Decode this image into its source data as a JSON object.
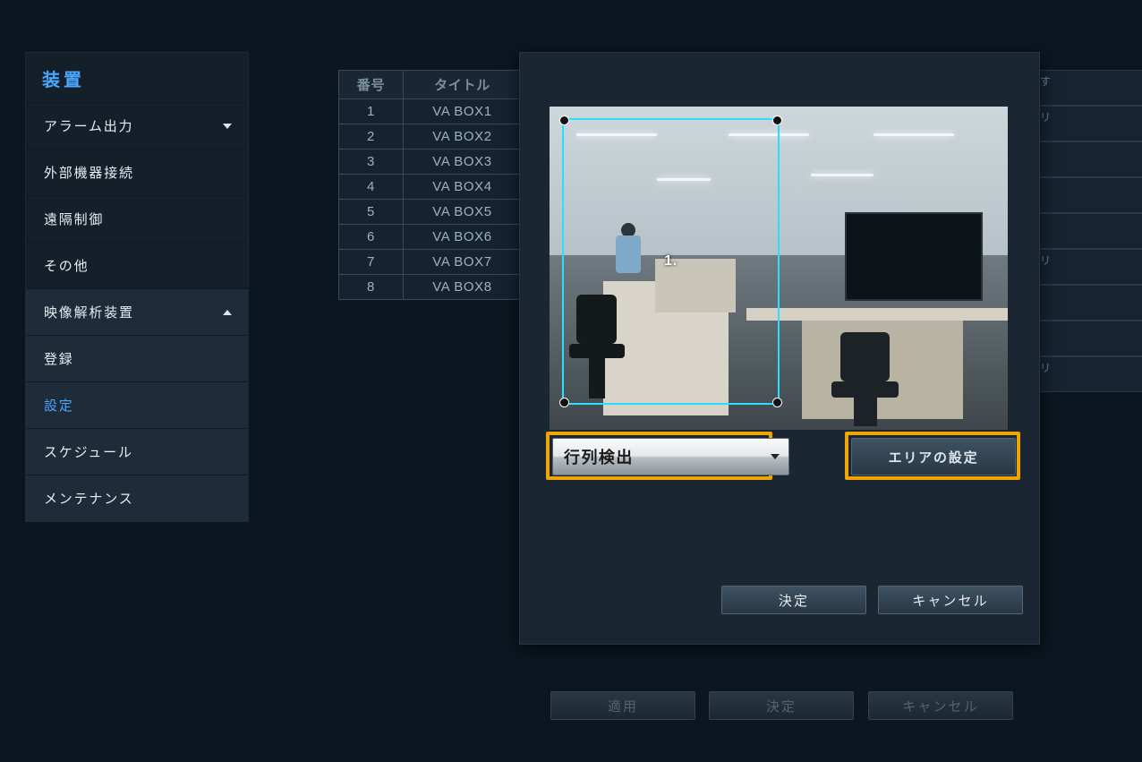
{
  "sidebar": {
    "title": "装置",
    "items": [
      {
        "label": "アラーム出力",
        "type": "collapsible",
        "state": "collapsed"
      },
      {
        "label": "外部機器接続",
        "type": "item"
      },
      {
        "label": "遠隔制御",
        "type": "item"
      },
      {
        "label": "その他",
        "type": "item"
      },
      {
        "label": "映像解析装置",
        "type": "collapsible",
        "state": "expanded",
        "children": [
          {
            "label": "登録"
          },
          {
            "label": "設定",
            "selected": true
          },
          {
            "label": "スケジュール"
          },
          {
            "label": "メンテナンス"
          }
        ]
      }
    ]
  },
  "bg_table": {
    "headers": [
      "番号",
      "タイトル"
    ],
    "rows": [
      [
        "1",
        "VA BOX1"
      ],
      [
        "2",
        "VA BOX2"
      ],
      [
        "3",
        "VA BOX3"
      ],
      [
        "4",
        "VA BOX4"
      ],
      [
        "5",
        "VA BOX5"
      ],
      [
        "6",
        "VA BOX6"
      ],
      [
        "7",
        "VA BOX7"
      ],
      [
        "8",
        "VA BOX8"
      ]
    ]
  },
  "bg_right": {
    "header_fragment": "す",
    "cells": [
      "リ",
      "",
      "",
      "",
      "リ",
      "",
      "",
      "リ"
    ]
  },
  "modal": {
    "region_label": "1.",
    "detection_select": {
      "value": "行列検出"
    },
    "area_button": "エリアの設定",
    "ok": "決定",
    "cancel": "キャンセル"
  },
  "global_buttons": {
    "apply": "適用",
    "ok": "決定",
    "cancel": "キャンセル"
  }
}
